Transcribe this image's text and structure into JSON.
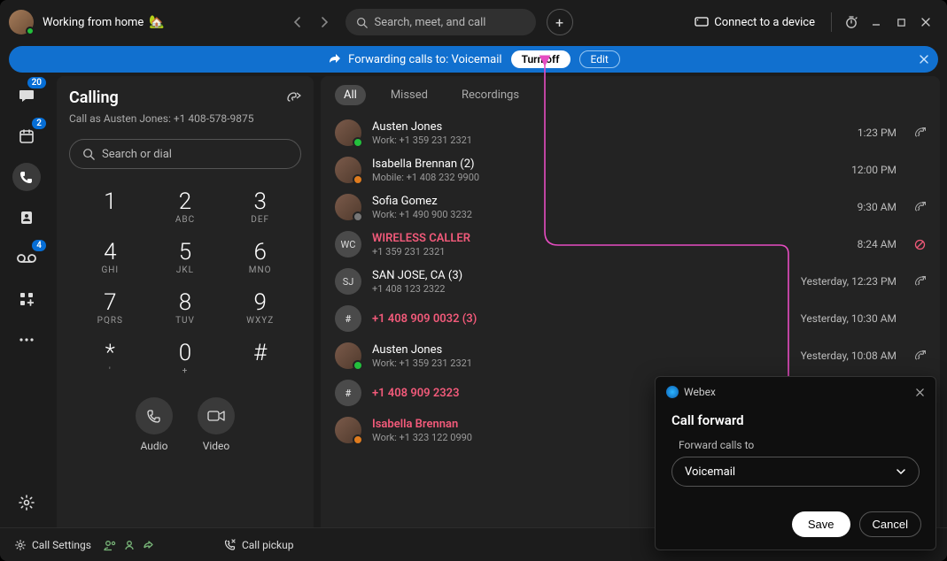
{
  "topbar": {
    "presence": "Working from home",
    "presence_emoji": "🏡",
    "search_placeholder": "Search, meet, and call",
    "connect_label": "Connect to a device"
  },
  "banner": {
    "icon": "forward-icon",
    "text": "Forwarding calls to: Voicemail",
    "turn_off": "Turn off",
    "edit": "Edit"
  },
  "rail": {
    "chat_badge": "20",
    "calendar_badge": "2",
    "voicemail_badge": "4"
  },
  "calling": {
    "title": "Calling",
    "subtitle": "Call as Austen Jones: +1 408-578-9875",
    "search_placeholder": "Search or dial",
    "keys": [
      {
        "num": "1",
        "sub": ""
      },
      {
        "num": "2",
        "sub": "ABC"
      },
      {
        "num": "3",
        "sub": "DEF"
      },
      {
        "num": "4",
        "sub": "GHI"
      },
      {
        "num": "5",
        "sub": "JKL"
      },
      {
        "num": "6",
        "sub": "MNO"
      },
      {
        "num": "7",
        "sub": "PQRS"
      },
      {
        "num": "8",
        "sub": "TUV"
      },
      {
        "num": "9",
        "sub": "WXYZ"
      },
      {
        "num": "*",
        "sub": "'"
      },
      {
        "num": "0",
        "sub": "+"
      },
      {
        "num": "#",
        "sub": ""
      }
    ],
    "audio_label": "Audio",
    "video_label": "Video"
  },
  "footer": {
    "call_settings": "Call Settings",
    "call_pickup": "Call pickup"
  },
  "history": {
    "tabs": {
      "all": "All",
      "missed": "Missed",
      "recordings": "Recordings"
    },
    "rows": [
      {
        "avatar": "photo",
        "corner": "green",
        "name": "Austen Jones",
        "missed": false,
        "detail": "Work: +1 359 231 2321",
        "time": "1:23 PM",
        "action": "out"
      },
      {
        "avatar": "photo",
        "corner": "orange",
        "name": "Isabella Brennan (2)",
        "missed": false,
        "detail": "Mobile: +1 408 232 9900",
        "time": "12:00 PM",
        "action": ""
      },
      {
        "avatar": "photo",
        "corner": "grey",
        "name": "Sofia Gomez",
        "missed": false,
        "detail": "Work: +1 490 900 3232",
        "time": "9:30 AM",
        "action": "out"
      },
      {
        "avatar": "WC",
        "corner": "",
        "name": "WIRELESS CALLER",
        "missed": true,
        "detail": "+1 359 231 2321",
        "time": "8:24 AM",
        "action": "blocked"
      },
      {
        "avatar": "SJ",
        "corner": "",
        "name": "SAN JOSE, CA (3)",
        "missed": false,
        "detail": "+1 408 123 2322",
        "time": "Yesterday, 12:23 PM",
        "action": "out"
      },
      {
        "avatar": "#",
        "corner": "",
        "name": "+1 408 909 0032 (3)",
        "missed": true,
        "detail": "",
        "time": "Yesterday, 10:30 AM",
        "action": ""
      },
      {
        "avatar": "photo",
        "corner": "green",
        "name": "Austen Jones",
        "missed": false,
        "detail": "Work: +1 359 231 2321",
        "time": "Yesterday, 10:08 AM",
        "action": "out"
      },
      {
        "avatar": "#",
        "corner": "",
        "name": "+1 408 909 2323",
        "missed": true,
        "detail": "",
        "time": "",
        "action": ""
      },
      {
        "avatar": "photo",
        "corner": "orange",
        "name": "Isabella Brennan",
        "missed": true,
        "detail": "Work: +1 323 122 0990",
        "time": "",
        "action": ""
      }
    ]
  },
  "dialog": {
    "brand": "Webex",
    "title": "Call forward",
    "label": "Forward calls to",
    "value": "Voicemail",
    "save": "Save",
    "cancel": "Cancel"
  }
}
